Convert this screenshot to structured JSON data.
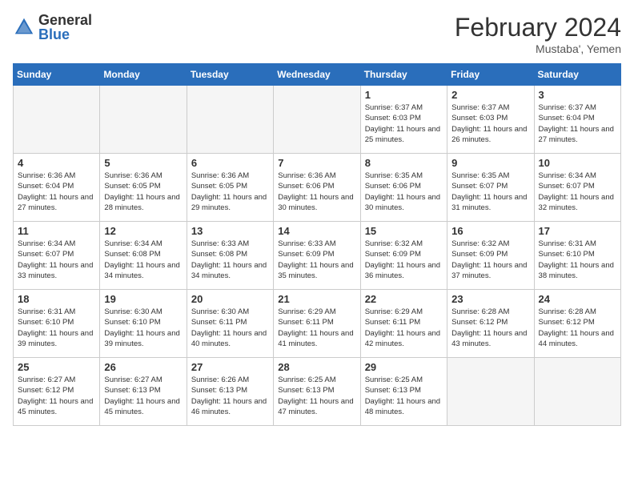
{
  "header": {
    "logo_general": "General",
    "logo_blue": "Blue",
    "month_title": "February 2024",
    "location": "Mustaba', Yemen"
  },
  "days_of_week": [
    "Sunday",
    "Monday",
    "Tuesday",
    "Wednesday",
    "Thursday",
    "Friday",
    "Saturday"
  ],
  "weeks": [
    [
      {
        "day": "",
        "info": ""
      },
      {
        "day": "",
        "info": ""
      },
      {
        "day": "",
        "info": ""
      },
      {
        "day": "",
        "info": ""
      },
      {
        "day": "1",
        "info": "Sunrise: 6:37 AM\nSunset: 6:03 PM\nDaylight: 11 hours and 25 minutes."
      },
      {
        "day": "2",
        "info": "Sunrise: 6:37 AM\nSunset: 6:03 PM\nDaylight: 11 hours and 26 minutes."
      },
      {
        "day": "3",
        "info": "Sunrise: 6:37 AM\nSunset: 6:04 PM\nDaylight: 11 hours and 27 minutes."
      }
    ],
    [
      {
        "day": "4",
        "info": "Sunrise: 6:36 AM\nSunset: 6:04 PM\nDaylight: 11 hours and 27 minutes."
      },
      {
        "day": "5",
        "info": "Sunrise: 6:36 AM\nSunset: 6:05 PM\nDaylight: 11 hours and 28 minutes."
      },
      {
        "day": "6",
        "info": "Sunrise: 6:36 AM\nSunset: 6:05 PM\nDaylight: 11 hours and 29 minutes."
      },
      {
        "day": "7",
        "info": "Sunrise: 6:36 AM\nSunset: 6:06 PM\nDaylight: 11 hours and 30 minutes."
      },
      {
        "day": "8",
        "info": "Sunrise: 6:35 AM\nSunset: 6:06 PM\nDaylight: 11 hours and 30 minutes."
      },
      {
        "day": "9",
        "info": "Sunrise: 6:35 AM\nSunset: 6:07 PM\nDaylight: 11 hours and 31 minutes."
      },
      {
        "day": "10",
        "info": "Sunrise: 6:34 AM\nSunset: 6:07 PM\nDaylight: 11 hours and 32 minutes."
      }
    ],
    [
      {
        "day": "11",
        "info": "Sunrise: 6:34 AM\nSunset: 6:07 PM\nDaylight: 11 hours and 33 minutes."
      },
      {
        "day": "12",
        "info": "Sunrise: 6:34 AM\nSunset: 6:08 PM\nDaylight: 11 hours and 34 minutes."
      },
      {
        "day": "13",
        "info": "Sunrise: 6:33 AM\nSunset: 6:08 PM\nDaylight: 11 hours and 34 minutes."
      },
      {
        "day": "14",
        "info": "Sunrise: 6:33 AM\nSunset: 6:09 PM\nDaylight: 11 hours and 35 minutes."
      },
      {
        "day": "15",
        "info": "Sunrise: 6:32 AM\nSunset: 6:09 PM\nDaylight: 11 hours and 36 minutes."
      },
      {
        "day": "16",
        "info": "Sunrise: 6:32 AM\nSunset: 6:09 PM\nDaylight: 11 hours and 37 minutes."
      },
      {
        "day": "17",
        "info": "Sunrise: 6:31 AM\nSunset: 6:10 PM\nDaylight: 11 hours and 38 minutes."
      }
    ],
    [
      {
        "day": "18",
        "info": "Sunrise: 6:31 AM\nSunset: 6:10 PM\nDaylight: 11 hours and 39 minutes."
      },
      {
        "day": "19",
        "info": "Sunrise: 6:30 AM\nSunset: 6:10 PM\nDaylight: 11 hours and 39 minutes."
      },
      {
        "day": "20",
        "info": "Sunrise: 6:30 AM\nSunset: 6:11 PM\nDaylight: 11 hours and 40 minutes."
      },
      {
        "day": "21",
        "info": "Sunrise: 6:29 AM\nSunset: 6:11 PM\nDaylight: 11 hours and 41 minutes."
      },
      {
        "day": "22",
        "info": "Sunrise: 6:29 AM\nSunset: 6:11 PM\nDaylight: 11 hours and 42 minutes."
      },
      {
        "day": "23",
        "info": "Sunrise: 6:28 AM\nSunset: 6:12 PM\nDaylight: 11 hours and 43 minutes."
      },
      {
        "day": "24",
        "info": "Sunrise: 6:28 AM\nSunset: 6:12 PM\nDaylight: 11 hours and 44 minutes."
      }
    ],
    [
      {
        "day": "25",
        "info": "Sunrise: 6:27 AM\nSunset: 6:12 PM\nDaylight: 11 hours and 45 minutes."
      },
      {
        "day": "26",
        "info": "Sunrise: 6:27 AM\nSunset: 6:13 PM\nDaylight: 11 hours and 45 minutes."
      },
      {
        "day": "27",
        "info": "Sunrise: 6:26 AM\nSunset: 6:13 PM\nDaylight: 11 hours and 46 minutes."
      },
      {
        "day": "28",
        "info": "Sunrise: 6:25 AM\nSunset: 6:13 PM\nDaylight: 11 hours and 47 minutes."
      },
      {
        "day": "29",
        "info": "Sunrise: 6:25 AM\nSunset: 6:13 PM\nDaylight: 11 hours and 48 minutes."
      },
      {
        "day": "",
        "info": ""
      },
      {
        "day": "",
        "info": ""
      }
    ]
  ]
}
